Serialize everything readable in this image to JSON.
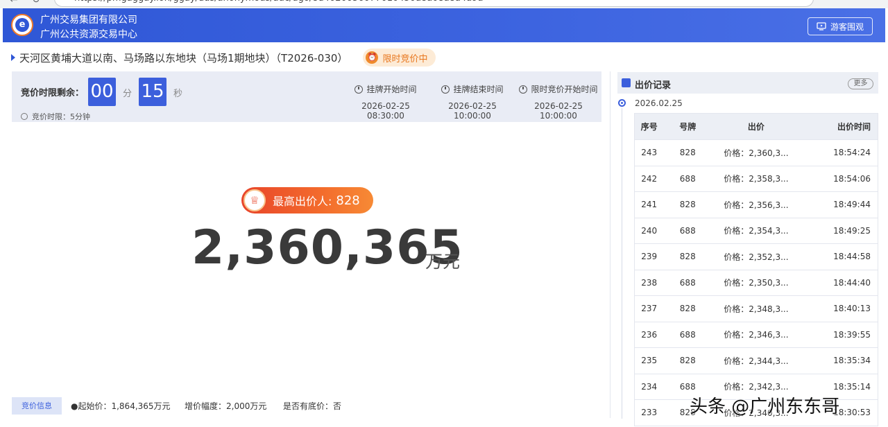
{
  "browser": {
    "url": "https://pmgaggay.ion/ggay/dus/anonymous/auc/ugo/8d4020056077010450a8a08a8a4a9a",
    "back_icon": "arrow-left-icon",
    "reload_icon": "reload-icon"
  },
  "header": {
    "org_name_1": "广州交易集团有限公司",
    "org_name_2": "广州公共资源交易中心",
    "guest_button": "游客围观",
    "brand_color": "#2f57d6"
  },
  "lot": {
    "title": "天河区黄埔大道以南、马场路以东地块（马场1期地块）（T2026-030）",
    "status": "限时竞价中",
    "status_color": "#e8761d"
  },
  "countdown": {
    "label": "竞价时限剩余：",
    "minutes": "00",
    "minutes_unit": "分",
    "seconds": "15",
    "seconds_unit": "秒",
    "limit_text": "竞价时限：5分钟"
  },
  "times": [
    {
      "label": "挂牌开始时间",
      "value": "2026-02-25 08:30:00"
    },
    {
      "label": "挂牌结束时间",
      "value": "2026-02-25 10:00:00"
    },
    {
      "label": "限时竞价开始时间",
      "value": "2026-02-25 10:00:00"
    }
  ],
  "highest": {
    "label": "最高出价人:",
    "bidder": "828",
    "price": "2,360,365",
    "unit": "万元"
  },
  "info": {
    "tag": "竞价信息",
    "start_price": "●起始价：1,864,365万元",
    "increment": "增价幅度：2,000万元",
    "reserve": "是否有底价：否"
  },
  "records": {
    "title": "出价记录",
    "more": "更多",
    "date": "2026.02.25",
    "columns": [
      "序号",
      "号牌",
      "出价",
      "出价时间"
    ],
    "rows": [
      [
        "243",
        "828",
        "价格：2,360,3...",
        "18:54:24"
      ],
      [
        "242",
        "688",
        "价格：2,358,3...",
        "18:54:06"
      ],
      [
        "241",
        "828",
        "价格：2,356,3...",
        "18:49:44"
      ],
      [
        "240",
        "688",
        "价格：2,354,3...",
        "18:49:25"
      ],
      [
        "239",
        "828",
        "价格：2,352,3...",
        "18:44:58"
      ],
      [
        "238",
        "688",
        "价格：2,350,3...",
        "18:44:40"
      ],
      [
        "237",
        "828",
        "价格：2,348,3...",
        "18:40:13"
      ],
      [
        "236",
        "688",
        "价格：2,346,3...",
        "18:39:55"
      ],
      [
        "235",
        "828",
        "价格：2,344,3...",
        "18:35:34"
      ],
      [
        "234",
        "688",
        "价格：2,342,3...",
        "18:35:14"
      ],
      [
        "233",
        "828",
        "价格：2,340,3...",
        "18:30:53"
      ]
    ]
  },
  "watermark": "头条 @广州东东哥"
}
